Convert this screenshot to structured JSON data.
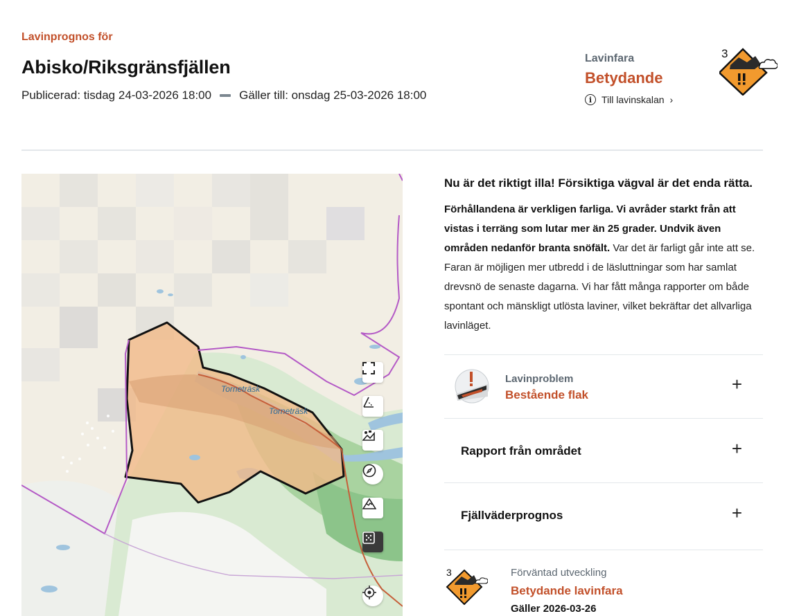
{
  "header": {
    "eyebrow": "Lavinprognos för",
    "title": "Abisko/Riksgränsfjällen",
    "published": "Publicerad: tisdag 24-03-2026 18:00",
    "valid_until": "Gäller till: onsdag 25-03-2026 18:00"
  },
  "danger": {
    "label": "Lavinfara",
    "level_name": "Betydande",
    "level_number": "3",
    "scale_link": "Till lavinskalan",
    "color": "#f29a2e"
  },
  "map": {
    "lake_label_1": "Torneträsk",
    "lake_label_2": "Torneträsk",
    "controls": [
      "fullscreen-icon",
      "measure-icon",
      "terrain-layer-icon",
      "compass-icon",
      "mountain-icon",
      "grid-layer-icon",
      "locate-icon"
    ]
  },
  "content": {
    "headline": "Nu är det riktigt illa! Försiktiga vägval är det enda rätta.",
    "bold_text": "Förhållandena är verkligen farliga. Vi avråder starkt från att vistas i terräng som lutar mer än 25 grader. Undvik även områden nedanför branta snöfält.",
    "normal_text": " Var det är farligt går inte att se. Faran är möjligen mer utbredd i de läsluttningar som har samlat drevsnö de senaste dagarna. Vi har fått många rapporter om både spontant och mänskligt utlösta laviner, vilket bekräftar det allvarliga lavinläget."
  },
  "accordion": {
    "problem_label": "Lavinproblem",
    "problem_value": "Bestående flak",
    "report_title": "Rapport från området",
    "weather_title": "Fjällväderprognos",
    "expand_symbol": "+"
  },
  "forecast": {
    "label": "Förväntad utveckling",
    "value": "Betydande lavinfara",
    "date": "Gäller 2026-03-26",
    "level_number": "3"
  }
}
